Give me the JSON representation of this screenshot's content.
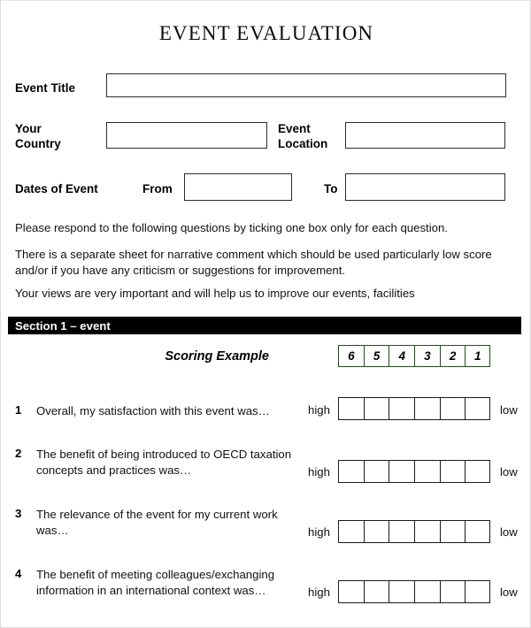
{
  "document": {
    "title": "EVENT EVALUATION"
  },
  "form": {
    "event_title": {
      "label": "Event Title",
      "value": "",
      "placeholder": ""
    },
    "your_country": {
      "label": "Your Country",
      "value": "",
      "placeholder": ""
    },
    "event_location": {
      "label": "Event Location",
      "value": "",
      "placeholder": ""
    },
    "dates": {
      "label": "Dates of Event",
      "from_label": "From",
      "from_value": "",
      "to_label": "To",
      "to_value": ""
    }
  },
  "instructions": [
    "Please respond to the following questions by ticking one box only for each question.",
    "There is a separate sheet for narrative comment which should be used particularly low score and/or if you have any criticism or suggestions for improvement.",
    "Your views are very important and will help us to improve our events, facilities"
  ],
  "section": {
    "header": "Section 1 – event",
    "header_background": "#000000",
    "header_color": "#ffffff"
  },
  "scoring_example": {
    "label": "Scoring Example",
    "scale": [
      "6",
      "5",
      "4",
      "3",
      "2",
      "1"
    ],
    "border_color": "#1d5016"
  },
  "scale_labels": {
    "high": "high",
    "low": "low"
  },
  "questions": [
    {
      "number": "1",
      "text": "Overall, my satisfaction with this event was…",
      "high": "high",
      "low": "low",
      "options": 6
    },
    {
      "number": "2",
      "text": "The benefit of being introduced to OECD taxation concepts and practices was…",
      "high": "high",
      "low": "low",
      "options": 6
    },
    {
      "number": "3",
      "text": "The relevance of the event for my current work was…",
      "high": "high",
      "low": "low",
      "options": 6
    },
    {
      "number": "4",
      "text": "The benefit of meeting colleagues/exchanging information in an international context was…",
      "high": "high",
      "low": "low",
      "options": 6
    }
  ]
}
